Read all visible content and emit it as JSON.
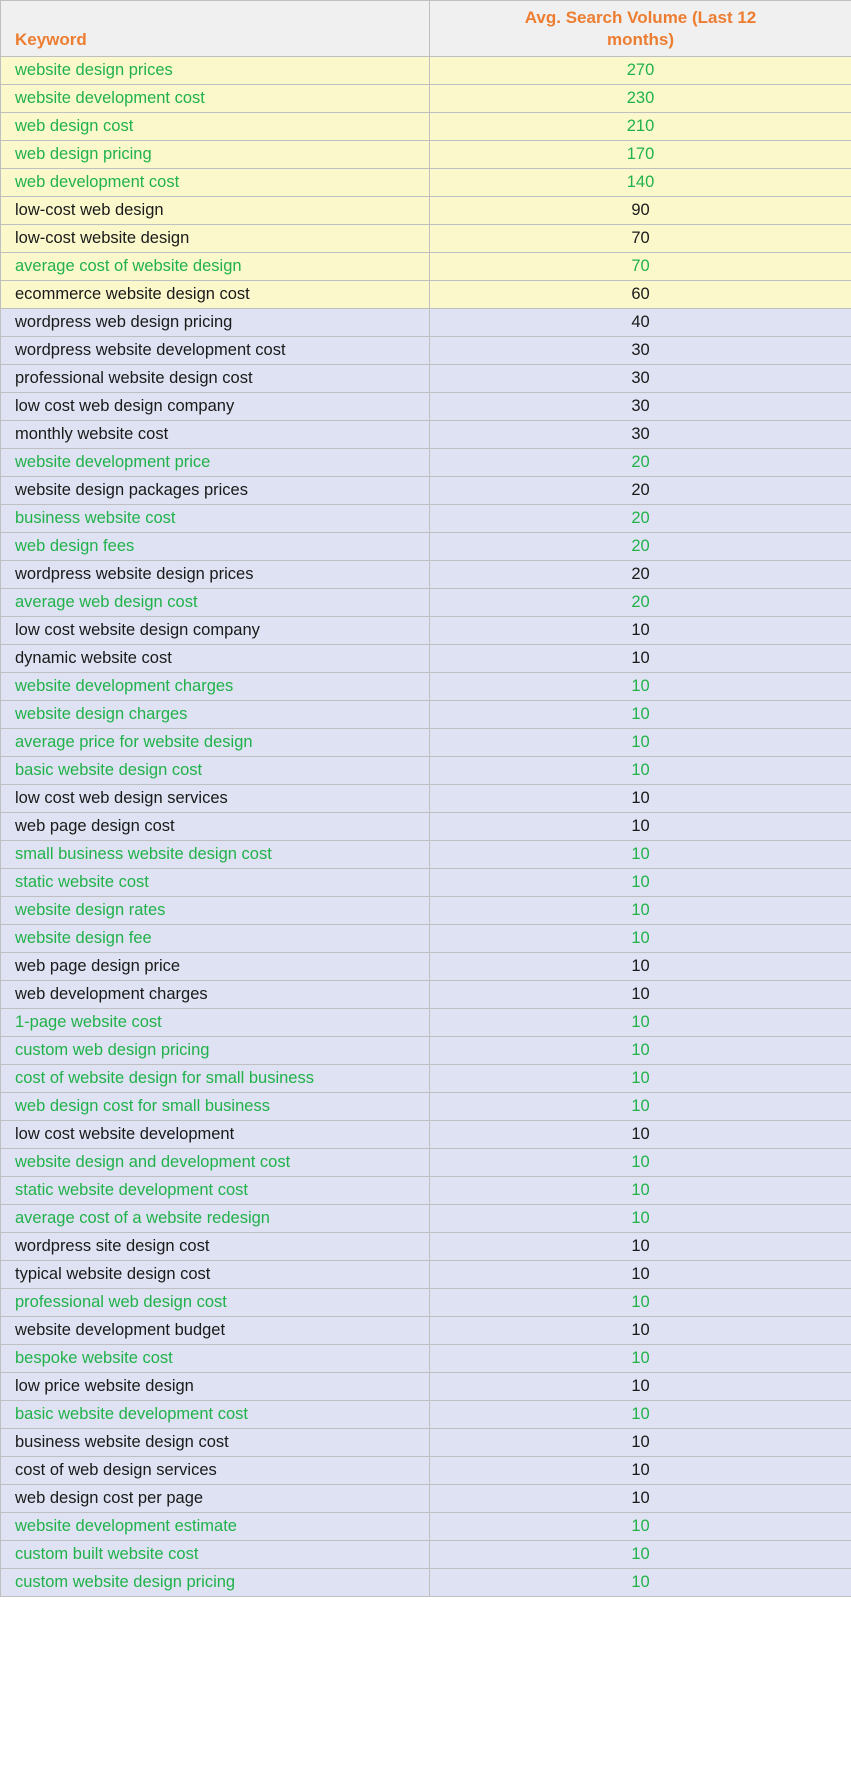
{
  "table": {
    "columns": [
      {
        "key": "keyword",
        "label": "Keyword",
        "align": "left"
      },
      {
        "key": "volume",
        "label": "Avg. Search Volume (Last 12 months)",
        "align": "center"
      }
    ],
    "header_text_color": "#ED7D31",
    "header_background": "#F0F0F0",
    "band_colors": {
      "yellow": "#FBF8CC",
      "blue": "#DEE2F2"
    },
    "text_colors": {
      "green": "#21B24B",
      "dark": "#1A1A1A"
    },
    "row_count": 55,
    "rows": [
      {
        "keyword": "website design prices",
        "volume": "270",
        "band": "yellow",
        "text": "green"
      },
      {
        "keyword": "website development cost",
        "volume": "230",
        "band": "yellow",
        "text": "green"
      },
      {
        "keyword": "web design cost",
        "volume": "210",
        "band": "yellow",
        "text": "green"
      },
      {
        "keyword": "web design pricing",
        "volume": "170",
        "band": "yellow",
        "text": "green"
      },
      {
        "keyword": "web development cost",
        "volume": "140",
        "band": "yellow",
        "text": "green"
      },
      {
        "keyword": "low-cost web design",
        "volume": "90",
        "band": "yellow",
        "text": "dark"
      },
      {
        "keyword": "low-cost website design",
        "volume": "70",
        "band": "yellow",
        "text": "dark"
      },
      {
        "keyword": "average cost of website design",
        "volume": "70",
        "band": "yellow",
        "text": "green"
      },
      {
        "keyword": "ecommerce website design cost",
        "volume": "60",
        "band": "yellow",
        "text": "dark"
      },
      {
        "keyword": "wordpress web design pricing",
        "volume": "40",
        "band": "blue",
        "text": "dark"
      },
      {
        "keyword": "wordpress website development cost",
        "volume": "30",
        "band": "blue",
        "text": "dark"
      },
      {
        "keyword": "professional website design cost",
        "volume": "30",
        "band": "blue",
        "text": "dark"
      },
      {
        "keyword": "low cost web design company",
        "volume": "30",
        "band": "blue",
        "text": "dark"
      },
      {
        "keyword": "monthly website cost",
        "volume": "30",
        "band": "blue",
        "text": "dark"
      },
      {
        "keyword": "website development price",
        "volume": "20",
        "band": "blue",
        "text": "green"
      },
      {
        "keyword": "website design packages prices",
        "volume": "20",
        "band": "blue",
        "text": "dark"
      },
      {
        "keyword": "business website cost",
        "volume": "20",
        "band": "blue",
        "text": "green"
      },
      {
        "keyword": "web design fees",
        "volume": "20",
        "band": "blue",
        "text": "green"
      },
      {
        "keyword": "wordpress website design prices",
        "volume": "20",
        "band": "blue",
        "text": "dark"
      },
      {
        "keyword": "average web design cost",
        "volume": "20",
        "band": "blue",
        "text": "green"
      },
      {
        "keyword": "low cost website design company",
        "volume": "10",
        "band": "blue",
        "text": "dark"
      },
      {
        "keyword": "dynamic website cost",
        "volume": "10",
        "band": "blue",
        "text": "dark"
      },
      {
        "keyword": "website development charges",
        "volume": "10",
        "band": "blue",
        "text": "green"
      },
      {
        "keyword": "website design charges",
        "volume": "10",
        "band": "blue",
        "text": "green"
      },
      {
        "keyword": "average price for website design",
        "volume": "10",
        "band": "blue",
        "text": "green"
      },
      {
        "keyword": "basic website design cost",
        "volume": "10",
        "band": "blue",
        "text": "green"
      },
      {
        "keyword": "low cost web design services",
        "volume": "10",
        "band": "blue",
        "text": "dark"
      },
      {
        "keyword": "web page design cost",
        "volume": "10",
        "band": "blue",
        "text": "dark"
      },
      {
        "keyword": "small business website design cost",
        "volume": "10",
        "band": "blue",
        "text": "green"
      },
      {
        "keyword": "static website cost",
        "volume": "10",
        "band": "blue",
        "text": "green"
      },
      {
        "keyword": "website design rates",
        "volume": "10",
        "band": "blue",
        "text": "green"
      },
      {
        "keyword": "website design fee",
        "volume": "10",
        "band": "blue",
        "text": "green"
      },
      {
        "keyword": "web page design price",
        "volume": "10",
        "band": "blue",
        "text": "dark"
      },
      {
        "keyword": "web development charges",
        "volume": "10",
        "band": "blue",
        "text": "dark"
      },
      {
        "keyword": "1-page website cost",
        "volume": "10",
        "band": "blue",
        "text": "green"
      },
      {
        "keyword": "custom web design pricing",
        "volume": "10",
        "band": "blue",
        "text": "green"
      },
      {
        "keyword": "cost of website design for small business",
        "volume": "10",
        "band": "blue",
        "text": "green"
      },
      {
        "keyword": "web design cost for small business",
        "volume": "10",
        "band": "blue",
        "text": "green"
      },
      {
        "keyword": "low cost website development",
        "volume": "10",
        "band": "blue",
        "text": "dark"
      },
      {
        "keyword": "website design and development cost",
        "volume": "10",
        "band": "blue",
        "text": "green"
      },
      {
        "keyword": "static website development cost",
        "volume": "10",
        "band": "blue",
        "text": "green"
      },
      {
        "keyword": "average cost of a website redesign",
        "volume": "10",
        "band": "blue",
        "text": "green"
      },
      {
        "keyword": "wordpress site design cost",
        "volume": "10",
        "band": "blue",
        "text": "dark"
      },
      {
        "keyword": "typical website design cost",
        "volume": "10",
        "band": "blue",
        "text": "dark"
      },
      {
        "keyword": "professional web design cost",
        "volume": "10",
        "band": "blue",
        "text": "green"
      },
      {
        "keyword": "website development budget",
        "volume": "10",
        "band": "blue",
        "text": "dark"
      },
      {
        "keyword": "bespoke website cost",
        "volume": "10",
        "band": "blue",
        "text": "green"
      },
      {
        "keyword": "low price website design",
        "volume": "10",
        "band": "blue",
        "text": "dark"
      },
      {
        "keyword": "basic website development cost",
        "volume": "10",
        "band": "blue",
        "text": "green"
      },
      {
        "keyword": "business website design cost",
        "volume": "10",
        "band": "blue",
        "text": "dark"
      },
      {
        "keyword": "cost of web design services",
        "volume": "10",
        "band": "blue",
        "text": "dark"
      },
      {
        "keyword": "web design cost per page",
        "volume": "10",
        "band": "blue",
        "text": "dark"
      },
      {
        "keyword": "website development estimate",
        "volume": "10",
        "band": "blue",
        "text": "green"
      },
      {
        "keyword": "custom built website cost",
        "volume": "10",
        "band": "blue",
        "text": "green"
      },
      {
        "keyword": "custom website design pricing",
        "volume": "10",
        "band": "blue",
        "text": "green"
      }
    ]
  },
  "chart_data": {
    "type": "table",
    "title": "",
    "columns": [
      "Keyword",
      "Avg. Search Volume (Last 12 months)"
    ],
    "categories": [
      "website design prices",
      "website development cost",
      "web design cost",
      "web design pricing",
      "web development cost",
      "low-cost web design",
      "low-cost website design",
      "average cost of website design",
      "ecommerce website design cost",
      "wordpress web design pricing",
      "wordpress website development cost",
      "professional website design cost",
      "low cost web design company",
      "monthly website cost",
      "website development price",
      "website design packages prices",
      "business website cost",
      "web design fees",
      "wordpress website design prices",
      "average web design cost",
      "low cost website design company",
      "dynamic website cost",
      "website development charges",
      "website design charges",
      "average price for website design",
      "basic website design cost",
      "low cost web design services",
      "web page design cost",
      "small business website design cost",
      "static website cost",
      "website design rates",
      "website design fee",
      "web page design price",
      "web development charges",
      "1-page website cost",
      "custom web design pricing",
      "cost of website design for small business",
      "web design cost for small business",
      "low cost website development",
      "website design and development cost",
      "static website development cost",
      "average cost of a website redesign",
      "wordpress site design cost",
      "typical website design cost",
      "professional web design cost",
      "website development budget",
      "bespoke website cost",
      "low price website design",
      "basic website development cost",
      "business website design cost",
      "cost of web design services",
      "web design cost per page",
      "website development estimate",
      "custom built website cost",
      "custom website design pricing"
    ],
    "values": [
      270,
      230,
      210,
      170,
      140,
      90,
      70,
      70,
      60,
      40,
      30,
      30,
      30,
      30,
      20,
      20,
      20,
      20,
      20,
      20,
      10,
      10,
      10,
      10,
      10,
      10,
      10,
      10,
      10,
      10,
      10,
      10,
      10,
      10,
      10,
      10,
      10,
      10,
      10,
      10,
      10,
      10,
      10,
      10,
      10,
      10,
      10,
      10,
      10,
      10,
      10,
      10,
      10,
      10,
      10
    ],
    "xlabel": "Keyword",
    "ylabel": "Avg. Search Volume (Last 12 months)"
  }
}
